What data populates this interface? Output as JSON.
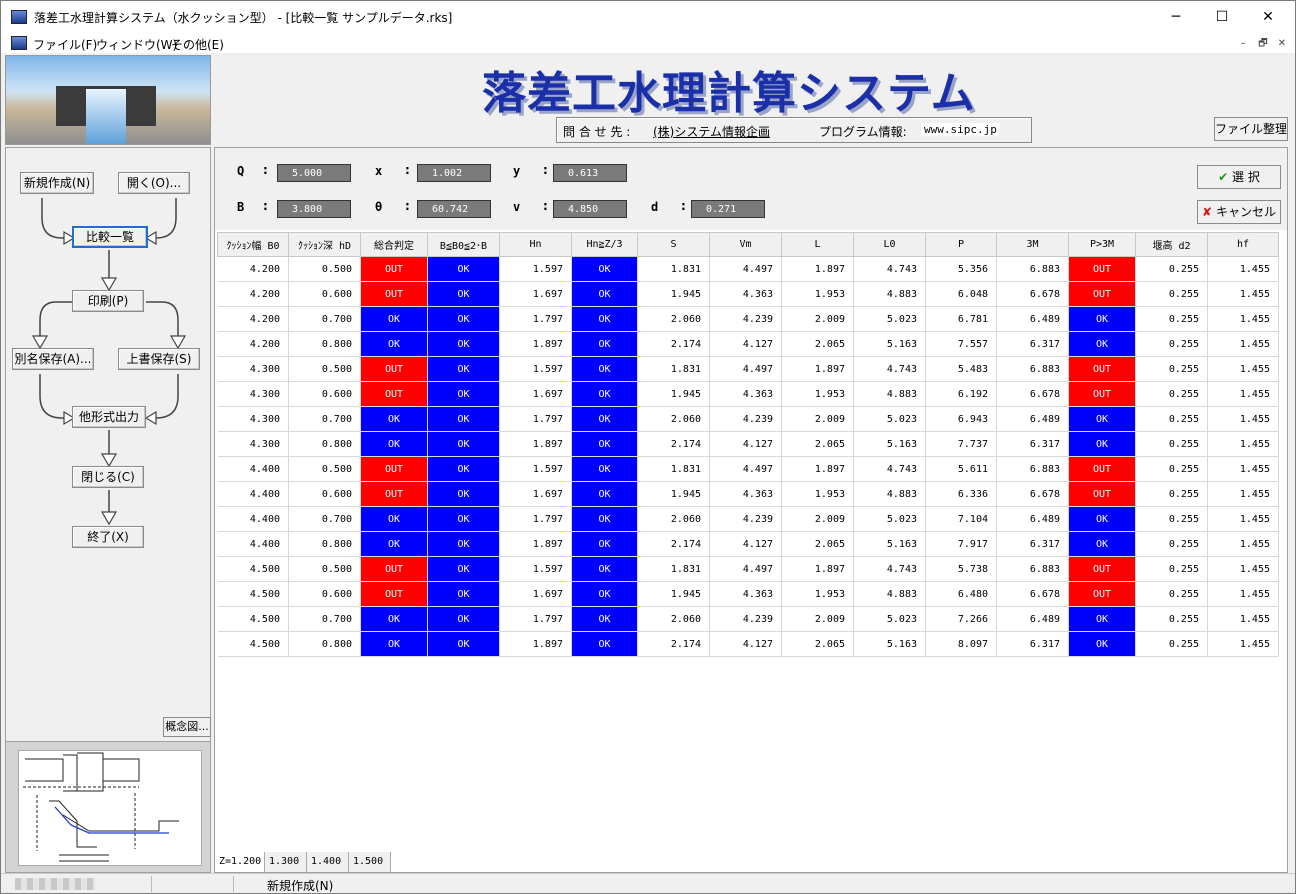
{
  "window": {
    "title": "落差工水理計算システム（水クッション型） - [比較一覧 サンプルデータ.rks]",
    "minimize": "─",
    "maximize": "☐",
    "close": "✕"
  },
  "menu": {
    "file": "ファイル(F)",
    "window": "ウィンドウ(W)",
    "other": "その他(E)",
    "mdi_min": "–",
    "mdi_restore": "🗗",
    "mdi_close": "✕"
  },
  "flow": {
    "new": "新規作成(N)",
    "open": "開く(O)...",
    "compare": "比較一覧",
    "print": "印刷(P)",
    "save_as": "別名保存(A)...",
    "overwrite": "上書保存(S)",
    "export": "他形式出力",
    "close": "閉じる(C)",
    "exit": "終了(X)",
    "concept": "概念図..."
  },
  "header": {
    "title": "落差工水理計算システム",
    "contact_label": "問 合 せ 先 :",
    "contact_company": "(株)システム情報企画",
    "program_label": "プログラム情報:",
    "program_url": "www.sipc.jp",
    "file_button": "ファイル整理"
  },
  "params": {
    "Q_label": "Q",
    "Q": "5.000",
    "x_label": "x",
    "x": "1.002",
    "y_label": "y",
    "y": "0.613",
    "B_label": "B",
    "B": "3.800",
    "theta_label": "θ",
    "theta": "60.742",
    "v_label": "v",
    "v": "4.850",
    "d_label": "d",
    "d": "0.271",
    "colon": ":"
  },
  "actions": {
    "select": "選 択",
    "cancel": "キャンセル"
  },
  "table": {
    "headers": [
      "ｸｯｼｮﾝ幅 B0",
      "ｸｯｼｮﾝ深 hD",
      "総合判定",
      "B≦B0≦2･B",
      "Hn",
      "Hn≧Z/3",
      "S",
      "Vm",
      "L",
      "L0",
      "P",
      "3M",
      "P>3M",
      "堰高 d2",
      "hf"
    ],
    "rows": [
      [
        "4.200",
        "0.500",
        "OUT",
        "OK",
        "1.597",
        "OK",
        "1.831",
        "4.497",
        "1.897",
        "4.743",
        "5.356",
        "6.883",
        "OUT",
        "0.255",
        "1.455"
      ],
      [
        "4.200",
        "0.600",
        "OUT",
        "OK",
        "1.697",
        "OK",
        "1.945",
        "4.363",
        "1.953",
        "4.883",
        "6.048",
        "6.678",
        "OUT",
        "0.255",
        "1.455"
      ],
      [
        "4.200",
        "0.700",
        "OK",
        "OK",
        "1.797",
        "OK",
        "2.060",
        "4.239",
        "2.009",
        "5.023",
        "6.781",
        "6.489",
        "OK",
        "0.255",
        "1.455"
      ],
      [
        "4.200",
        "0.800",
        "OK",
        "OK",
        "1.897",
        "OK",
        "2.174",
        "4.127",
        "2.065",
        "5.163",
        "7.557",
        "6.317",
        "OK",
        "0.255",
        "1.455"
      ],
      [
        "4.300",
        "0.500",
        "OUT",
        "OK",
        "1.597",
        "OK",
        "1.831",
        "4.497",
        "1.897",
        "4.743",
        "5.483",
        "6.883",
        "OUT",
        "0.255",
        "1.455"
      ],
      [
        "4.300",
        "0.600",
        "OUT",
        "OK",
        "1.697",
        "OK",
        "1.945",
        "4.363",
        "1.953",
        "4.883",
        "6.192",
        "6.678",
        "OUT",
        "0.255",
        "1.455"
      ],
      [
        "4.300",
        "0.700",
        "OK",
        "OK",
        "1.797",
        "OK",
        "2.060",
        "4.239",
        "2.009",
        "5.023",
        "6.943",
        "6.489",
        "OK",
        "0.255",
        "1.455"
      ],
      [
        "4.300",
        "0.800",
        "OK",
        "OK",
        "1.897",
        "OK",
        "2.174",
        "4.127",
        "2.065",
        "5.163",
        "7.737",
        "6.317",
        "OK",
        "0.255",
        "1.455"
      ],
      [
        "4.400",
        "0.500",
        "OUT",
        "OK",
        "1.597",
        "OK",
        "1.831",
        "4.497",
        "1.897",
        "4.743",
        "5.611",
        "6.883",
        "OUT",
        "0.255",
        "1.455"
      ],
      [
        "4.400",
        "0.600",
        "OUT",
        "OK",
        "1.697",
        "OK",
        "1.945",
        "4.363",
        "1.953",
        "4.883",
        "6.336",
        "6.678",
        "OUT",
        "0.255",
        "1.455"
      ],
      [
        "4.400",
        "0.700",
        "OK",
        "OK",
        "1.797",
        "OK",
        "2.060",
        "4.239",
        "2.009",
        "5.023",
        "7.104",
        "6.489",
        "OK",
        "0.255",
        "1.455"
      ],
      [
        "4.400",
        "0.800",
        "OK",
        "OK",
        "1.897",
        "OK",
        "2.174",
        "4.127",
        "2.065",
        "5.163",
        "7.917",
        "6.317",
        "OK",
        "0.255",
        "1.455"
      ],
      [
        "4.500",
        "0.500",
        "OUT",
        "OK",
        "1.597",
        "OK",
        "1.831",
        "4.497",
        "1.897",
        "4.743",
        "5.738",
        "6.883",
        "OUT",
        "0.255",
        "1.455"
      ],
      [
        "4.500",
        "0.600",
        "OUT",
        "OK",
        "1.697",
        "OK",
        "1.945",
        "4.363",
        "1.953",
        "4.883",
        "6.480",
        "6.678",
        "OUT",
        "0.255",
        "1.455"
      ],
      [
        "4.500",
        "0.700",
        "OK",
        "OK",
        "1.797",
        "OK",
        "2.060",
        "4.239",
        "2.009",
        "5.023",
        "7.266",
        "6.489",
        "OK",
        "0.255",
        "1.455"
      ],
      [
        "4.500",
        "0.800",
        "OK",
        "OK",
        "1.897",
        "OK",
        "2.174",
        "4.127",
        "2.065",
        "5.163",
        "8.097",
        "6.317",
        "OK",
        "0.255",
        "1.455"
      ]
    ]
  },
  "z_tabs": [
    "Z=1.200",
    "1.300",
    "1.400",
    "1.500"
  ],
  "status": {
    "text": "新規作成(N)"
  },
  "colors": {
    "ok": "#0000ff",
    "out": "#ff0000",
    "title_blue": "#1a2fa8",
    "selected_border": "#1e6fd0"
  }
}
